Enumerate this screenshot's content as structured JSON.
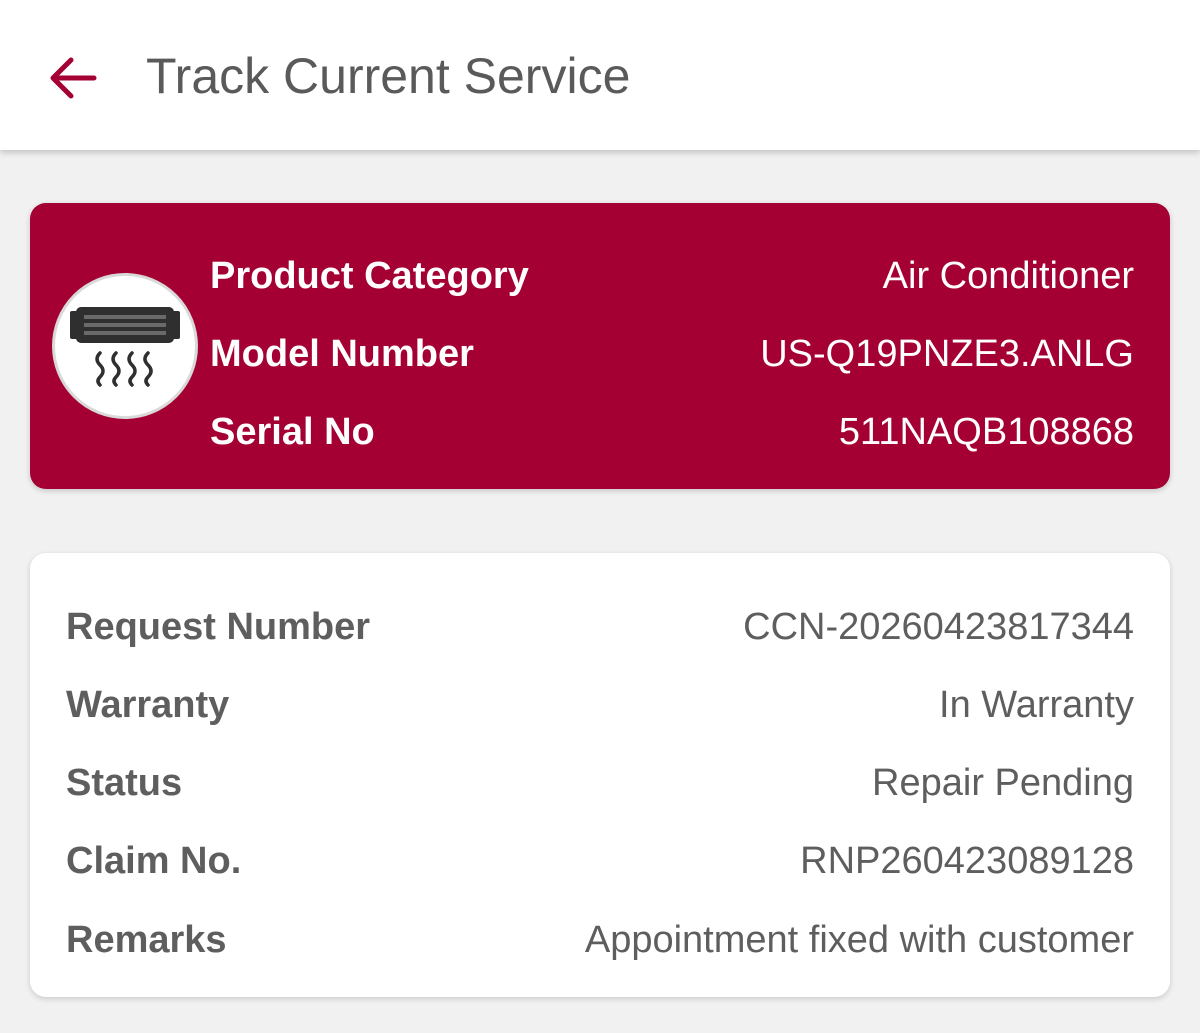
{
  "header": {
    "title": "Track Current Service",
    "back_icon": "arrow-left-icon"
  },
  "colors": {
    "brand": "#a50034",
    "text_gray": "#5e5e5e",
    "background": "#f1f1f1"
  },
  "product": {
    "icon": "air-conditioner-icon",
    "rows": [
      {
        "label": "Product Category",
        "value": "Air Conditioner"
      },
      {
        "label": "Model Number",
        "value": "US-Q19PNZE3.ANLG"
      },
      {
        "label": "Serial No",
        "value": "511NAQB108868"
      }
    ]
  },
  "details": {
    "rows": [
      {
        "label": "Request Number",
        "value": "CCN-20260423817344"
      },
      {
        "label": "Warranty",
        "value": "In Warranty"
      },
      {
        "label": "Status",
        "value": "Repair Pending"
      },
      {
        "label": "Claim No.",
        "value": "RNP260423089128"
      },
      {
        "label": "Remarks",
        "value": "Appointment fixed with customer"
      }
    ]
  }
}
